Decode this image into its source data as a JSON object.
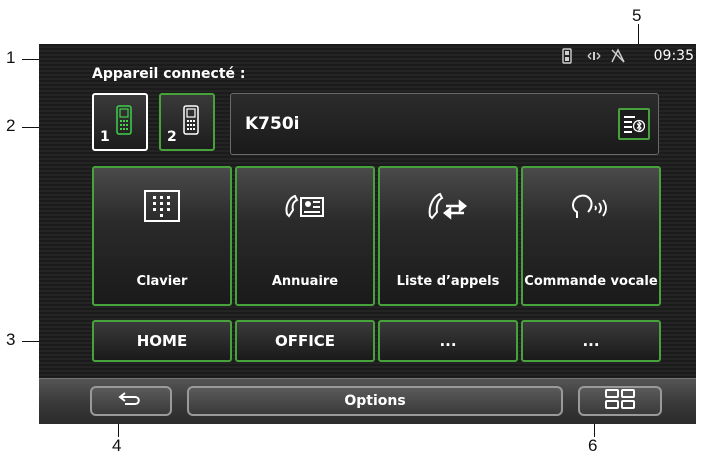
{
  "callouts": [
    "1",
    "2",
    "3",
    "4",
    "5",
    "6"
  ],
  "status_bar": {
    "time": "09:35",
    "icons": [
      "phone-icon",
      "signal-icon",
      "gps-no-signal-icon"
    ]
  },
  "header": {
    "connected_label": "Appareil connecté :"
  },
  "phones": [
    {
      "number": "1",
      "icon": "mobile-phone-icon",
      "state": "active"
    },
    {
      "number": "2",
      "icon": "mobile-phone-icon",
      "state": "inactive"
    }
  ],
  "device": {
    "name": "K750i",
    "action_icon": "bluetooth-list-icon"
  },
  "tiles": [
    {
      "label": "Clavier",
      "icon": "keypad-icon"
    },
    {
      "label": "Annuaire",
      "icon": "phonebook-icon"
    },
    {
      "label": "Liste d’appels",
      "icon": "call-list-icon"
    },
    {
      "label": "Commande vocale",
      "icon": "voice-command-icon"
    }
  ],
  "quick_dials": [
    "HOME",
    "OFFICE",
    "...",
    "..."
  ],
  "bottom_bar": {
    "back_icon": "back-arrow-icon",
    "options_label": "Options",
    "grid_icon": "grid-menu-icon"
  },
  "colors": {
    "accent": "#48a23c",
    "screen_bg": "#1f1f1f",
    "text": "#ffffff"
  }
}
